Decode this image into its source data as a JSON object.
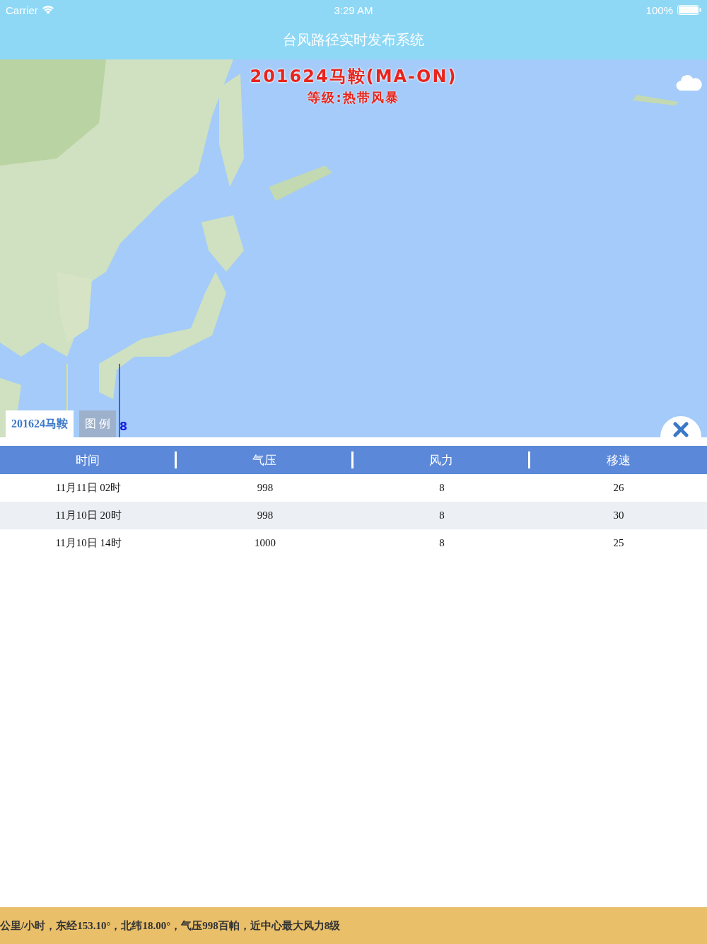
{
  "status_bar": {
    "carrier": "Carrier",
    "time": "3:29 AM",
    "battery": "100%"
  },
  "nav": {
    "title": "台风路径实时发布系统"
  },
  "map": {
    "typhoon_title": "201624马鞍(MA-ON)",
    "grade": "等级:热带风暴",
    "track_label": "8",
    "tabs": [
      {
        "label": "201624马鞍",
        "selected": true
      },
      {
        "label": "图 例",
        "selected": false
      }
    ]
  },
  "table": {
    "columns": [
      "时间",
      "气压",
      "风力",
      "移速"
    ],
    "rows": [
      {
        "cells": [
          "11月11日 02时",
          "998",
          "8",
          "26"
        ],
        "selected": false
      },
      {
        "cells": [
          "11月10日 20时",
          "998",
          "8",
          "30"
        ],
        "selected": true
      },
      {
        "cells": [
          "11月10日 14时",
          "1000",
          "8",
          "25"
        ],
        "selected": false
      }
    ]
  },
  "ticker": {
    "text": "公里/小时，东经153.10°，北纬18.00°，气压998百帕，近中心最大风力8级"
  }
}
